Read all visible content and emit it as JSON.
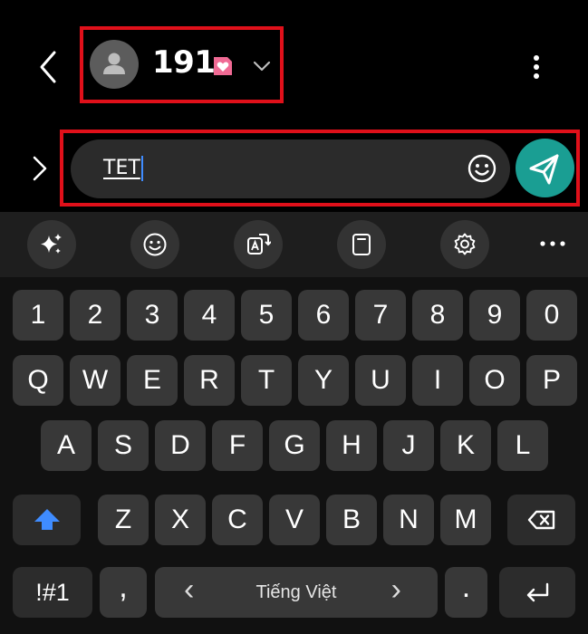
{
  "header": {
    "contact_name": "191",
    "icons": [
      "back-chevron-icon",
      "person-icon",
      "sim-heart-icon",
      "chevron-down-icon",
      "more-vert-icon"
    ]
  },
  "compose": {
    "input_value": "TET",
    "icons": [
      "expand-chevron-icon",
      "emoji-icon",
      "send-icon"
    ]
  },
  "toolbar": {
    "icons": [
      "ai-sparkle-icon",
      "emoji-icon",
      "translate-icon",
      "clipboard-icon",
      "settings-icon",
      "more-horiz-icon"
    ]
  },
  "keyboard": {
    "row_numbers": [
      "1",
      "2",
      "3",
      "4",
      "5",
      "6",
      "7",
      "8",
      "9",
      "0"
    ],
    "row_top": [
      "Q",
      "W",
      "E",
      "R",
      "T",
      "Y",
      "U",
      "I",
      "O",
      "P"
    ],
    "row_middle": [
      "A",
      "S",
      "D",
      "F",
      "G",
      "H",
      "J",
      "K",
      "L"
    ],
    "row_bottom": [
      "Z",
      "X",
      "C",
      "V",
      "B",
      "N",
      "M"
    ],
    "symbols_label": "!#1",
    "comma_label": ",",
    "period_label": ".",
    "space_label": "Tiếng Việt",
    "space_left_arrow": "‹",
    "space_right_arrow": "›"
  },
  "colors": {
    "highlight_border": "#e0101a",
    "send_button": "#1a9e93",
    "shift_active": "#3f8cff",
    "sim_badge": "#f06a94"
  }
}
